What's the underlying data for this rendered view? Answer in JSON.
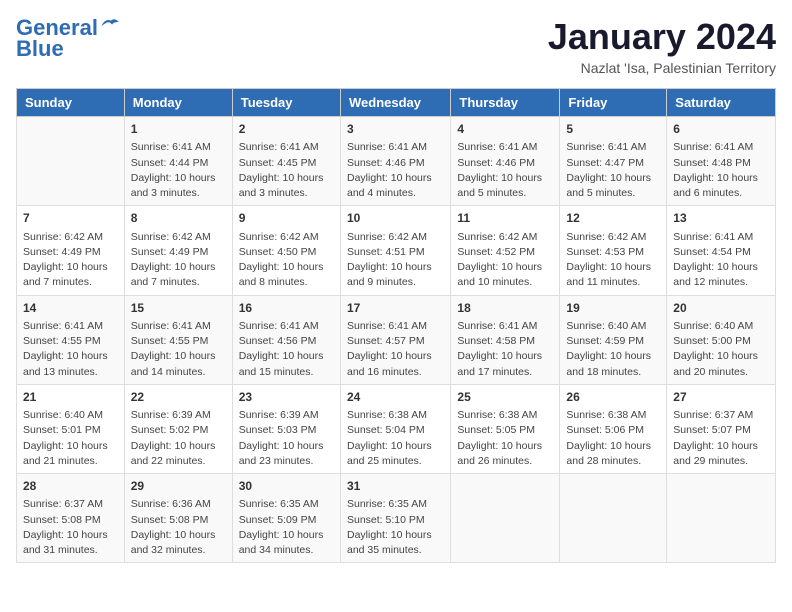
{
  "header": {
    "logo_line1": "General",
    "logo_line2": "Blue",
    "month_title": "January 2024",
    "subtitle": "Nazlat 'Isa, Palestinian Territory"
  },
  "days_of_week": [
    "Sunday",
    "Monday",
    "Tuesday",
    "Wednesday",
    "Thursday",
    "Friday",
    "Saturday"
  ],
  "weeks": [
    [
      {
        "day": "",
        "info": ""
      },
      {
        "day": "1",
        "info": "Sunrise: 6:41 AM\nSunset: 4:44 PM\nDaylight: 10 hours\nand 3 minutes."
      },
      {
        "day": "2",
        "info": "Sunrise: 6:41 AM\nSunset: 4:45 PM\nDaylight: 10 hours\nand 3 minutes."
      },
      {
        "day": "3",
        "info": "Sunrise: 6:41 AM\nSunset: 4:46 PM\nDaylight: 10 hours\nand 4 minutes."
      },
      {
        "day": "4",
        "info": "Sunrise: 6:41 AM\nSunset: 4:46 PM\nDaylight: 10 hours\nand 5 minutes."
      },
      {
        "day": "5",
        "info": "Sunrise: 6:41 AM\nSunset: 4:47 PM\nDaylight: 10 hours\nand 5 minutes."
      },
      {
        "day": "6",
        "info": "Sunrise: 6:41 AM\nSunset: 4:48 PM\nDaylight: 10 hours\nand 6 minutes."
      }
    ],
    [
      {
        "day": "7",
        "info": "Sunrise: 6:42 AM\nSunset: 4:49 PM\nDaylight: 10 hours\nand 7 minutes."
      },
      {
        "day": "8",
        "info": "Sunrise: 6:42 AM\nSunset: 4:49 PM\nDaylight: 10 hours\nand 7 minutes."
      },
      {
        "day": "9",
        "info": "Sunrise: 6:42 AM\nSunset: 4:50 PM\nDaylight: 10 hours\nand 8 minutes."
      },
      {
        "day": "10",
        "info": "Sunrise: 6:42 AM\nSunset: 4:51 PM\nDaylight: 10 hours\nand 9 minutes."
      },
      {
        "day": "11",
        "info": "Sunrise: 6:42 AM\nSunset: 4:52 PM\nDaylight: 10 hours\nand 10 minutes."
      },
      {
        "day": "12",
        "info": "Sunrise: 6:42 AM\nSunset: 4:53 PM\nDaylight: 10 hours\nand 11 minutes."
      },
      {
        "day": "13",
        "info": "Sunrise: 6:41 AM\nSunset: 4:54 PM\nDaylight: 10 hours\nand 12 minutes."
      }
    ],
    [
      {
        "day": "14",
        "info": "Sunrise: 6:41 AM\nSunset: 4:55 PM\nDaylight: 10 hours\nand 13 minutes."
      },
      {
        "day": "15",
        "info": "Sunrise: 6:41 AM\nSunset: 4:55 PM\nDaylight: 10 hours\nand 14 minutes."
      },
      {
        "day": "16",
        "info": "Sunrise: 6:41 AM\nSunset: 4:56 PM\nDaylight: 10 hours\nand 15 minutes."
      },
      {
        "day": "17",
        "info": "Sunrise: 6:41 AM\nSunset: 4:57 PM\nDaylight: 10 hours\nand 16 minutes."
      },
      {
        "day": "18",
        "info": "Sunrise: 6:41 AM\nSunset: 4:58 PM\nDaylight: 10 hours\nand 17 minutes."
      },
      {
        "day": "19",
        "info": "Sunrise: 6:40 AM\nSunset: 4:59 PM\nDaylight: 10 hours\nand 18 minutes."
      },
      {
        "day": "20",
        "info": "Sunrise: 6:40 AM\nSunset: 5:00 PM\nDaylight: 10 hours\nand 20 minutes."
      }
    ],
    [
      {
        "day": "21",
        "info": "Sunrise: 6:40 AM\nSunset: 5:01 PM\nDaylight: 10 hours\nand 21 minutes."
      },
      {
        "day": "22",
        "info": "Sunrise: 6:39 AM\nSunset: 5:02 PM\nDaylight: 10 hours\nand 22 minutes."
      },
      {
        "day": "23",
        "info": "Sunrise: 6:39 AM\nSunset: 5:03 PM\nDaylight: 10 hours\nand 23 minutes."
      },
      {
        "day": "24",
        "info": "Sunrise: 6:38 AM\nSunset: 5:04 PM\nDaylight: 10 hours\nand 25 minutes."
      },
      {
        "day": "25",
        "info": "Sunrise: 6:38 AM\nSunset: 5:05 PM\nDaylight: 10 hours\nand 26 minutes."
      },
      {
        "day": "26",
        "info": "Sunrise: 6:38 AM\nSunset: 5:06 PM\nDaylight: 10 hours\nand 28 minutes."
      },
      {
        "day": "27",
        "info": "Sunrise: 6:37 AM\nSunset: 5:07 PM\nDaylight: 10 hours\nand 29 minutes."
      }
    ],
    [
      {
        "day": "28",
        "info": "Sunrise: 6:37 AM\nSunset: 5:08 PM\nDaylight: 10 hours\nand 31 minutes."
      },
      {
        "day": "29",
        "info": "Sunrise: 6:36 AM\nSunset: 5:08 PM\nDaylight: 10 hours\nand 32 minutes."
      },
      {
        "day": "30",
        "info": "Sunrise: 6:35 AM\nSunset: 5:09 PM\nDaylight: 10 hours\nand 34 minutes."
      },
      {
        "day": "31",
        "info": "Sunrise: 6:35 AM\nSunset: 5:10 PM\nDaylight: 10 hours\nand 35 minutes."
      },
      {
        "day": "",
        "info": ""
      },
      {
        "day": "",
        "info": ""
      },
      {
        "day": "",
        "info": ""
      }
    ]
  ]
}
